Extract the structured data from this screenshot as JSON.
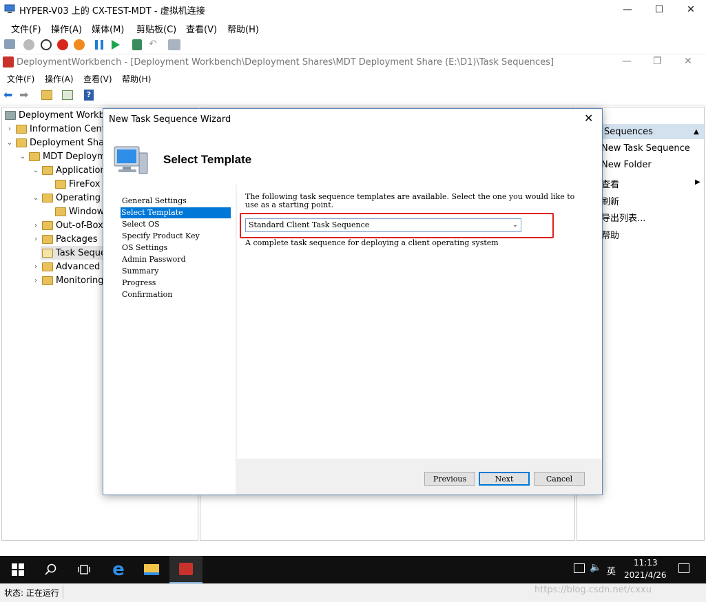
{
  "host": {
    "title": "HYPER-V03 上的 CX-TEST-MDT - 虚拟机连接",
    "menu": [
      "文件(F)",
      "操作(A)",
      "媒体(M)",
      "剪贴板(C)",
      "查看(V)",
      "帮助(H)"
    ],
    "window_controls": {
      "minimize": "—",
      "maximize": "☐",
      "close": "✕"
    }
  },
  "mmc": {
    "title": "DeploymentWorkbench - [Deployment Workbench\\Deployment Shares\\MDT Deployment Share (E:\\D1)\\Task Sequences]",
    "menu": [
      "文件(F)",
      "操作(A)",
      "查看(V)",
      "帮助(H)"
    ],
    "window_controls": {
      "minimize": "—",
      "restore": "❐",
      "close": "✕"
    }
  },
  "tree": {
    "items": [
      {
        "label": "Deployment Workbe"
      },
      {
        "label": "Information Cente"
      },
      {
        "label": "Deployment Share"
      },
      {
        "label": "MDT Deploym"
      },
      {
        "label": "Application"
      },
      {
        "label": "FireFox"
      },
      {
        "label": "Operating S"
      },
      {
        "label": "Window"
      },
      {
        "label": "Out-of-Box"
      },
      {
        "label": "Packages"
      },
      {
        "label": "Task Seque"
      },
      {
        "label": "Advanced C"
      },
      {
        "label": "Monitoring"
      }
    ]
  },
  "actions": {
    "header": "Sequences",
    "items": [
      "New Task Sequence",
      "New Folder",
      "查看",
      "刷新",
      "导出列表...",
      "帮助"
    ]
  },
  "wizard": {
    "title": "New Task Sequence Wizard",
    "heading": "Select Template",
    "steps": [
      "General Settings",
      "Select Template",
      "Select OS",
      "Specify Product Key",
      "OS Settings",
      "Admin Password",
      "Summary",
      "Progress",
      "Confirmation"
    ],
    "active_step": "Select Template",
    "description": "The following task sequence templates are available.  Select the one you would like to use as a starting point.",
    "template_selected": "Standard Client Task Sequence",
    "template_caption": "A complete task sequence for deploying a client operating system",
    "buttons": {
      "previous": "Previous",
      "next": "Next",
      "cancel": "Cancel"
    }
  },
  "taskbar": {
    "time": "11:13",
    "date": "2021/4/26",
    "language": "英"
  },
  "status": {
    "text": "状态: 正在运行"
  },
  "watermark": "https://blog.csdn.net/cxxu"
}
